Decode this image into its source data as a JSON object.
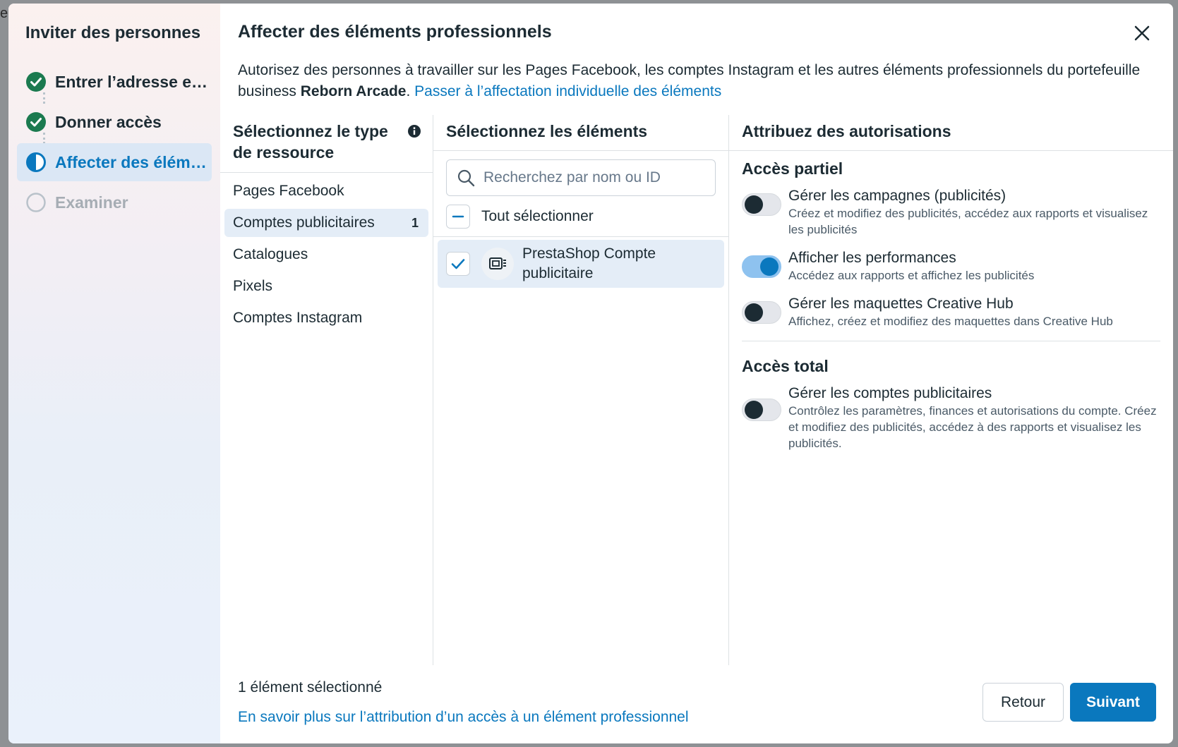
{
  "stepper": {
    "title": "Inviter des personnes",
    "steps": [
      {
        "label": "Entrer l’adresse e…",
        "state": "done"
      },
      {
        "label": "Donner accès",
        "state": "done"
      },
      {
        "label": "Affecter des élém…",
        "state": "active"
      },
      {
        "label": "Examiner",
        "state": "pending"
      }
    ]
  },
  "dialog": {
    "title": "Affecter des éléments professionnels",
    "intro_text": "Autorisez des personnes à travailler sur les Pages Facebook, les comptes Instagram et les autres éléments professionnels du portefeuille business ",
    "business_name": "Reborn Arcade",
    "intro_period": ".",
    "intro_link": "Passer à l’affectation individuelle des éléments"
  },
  "resource_column": {
    "header": "Sélectionnez le type de ressource",
    "items": [
      {
        "label": "Pages Facebook",
        "count": ""
      },
      {
        "label": "Comptes publicitaires",
        "count": "1",
        "selected": true
      },
      {
        "label": "Catalogues",
        "count": ""
      },
      {
        "label": "Pixels",
        "count": ""
      },
      {
        "label": "Comptes Instagram",
        "count": ""
      }
    ]
  },
  "assets_column": {
    "header": "Sélectionnez les éléments",
    "search_placeholder": "Recherchez par nom ou ID",
    "select_all_label": "Tout sélectionner",
    "assets": [
      {
        "name": "PrestaShop Compte publicitaire",
        "checked": true
      }
    ]
  },
  "permissions_column": {
    "header": "Attribuez des autorisations",
    "partial": {
      "title": "Accès partiel",
      "items": [
        {
          "name": "Gérer les campagnes (publicités)",
          "desc": "Créez et modifiez des publicités, accédez aux rapports et visualisez les publicités",
          "on": false
        },
        {
          "name": "Afficher les performances",
          "desc": "Accédez aux rapports et affichez les publicités",
          "on": true
        },
        {
          "name": "Gérer les maquettes Creative Hub",
          "desc": "Affichez, créez et modifiez des maquettes dans Creative Hub",
          "on": false
        }
      ]
    },
    "full": {
      "title": "Accès total",
      "items": [
        {
          "name": "Gérer les comptes publicitaires",
          "desc": "Contrôlez les paramètres, finances et autorisations du compte. Créez et modifiez des publicités, accédez à des rapports et visualisez les publicités.",
          "on": false
        }
      ]
    }
  },
  "footer": {
    "selected_count": "1 élément sélectionné",
    "learn_more_link": "En savoir plus sur l’attribution d’un accès à un élément professionnel",
    "back_label": "Retour",
    "next_label": "Suivant"
  },
  "colors": {
    "accent": "#0a78be",
    "done_green": "#1b7a4f",
    "toggle_on_track": "#8ec2ef"
  },
  "icons": {
    "close": "close-icon",
    "info": "info-icon",
    "search": "search-icon",
    "check": "checkmark-icon",
    "minus": "minus-icon",
    "ad_account": "ad-account-icon"
  }
}
